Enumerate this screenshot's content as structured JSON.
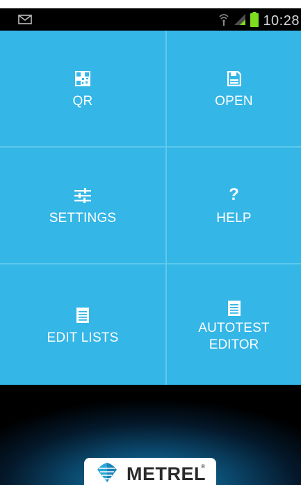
{
  "status_bar": {
    "time": "10:28",
    "icons": [
      "mail-icon",
      "wifi-icon",
      "signal-icon",
      "battery-icon"
    ],
    "battery_color": "#7ddc1f"
  },
  "menu": {
    "tiles": [
      {
        "label": "QR",
        "icon": "qr-code-icon"
      },
      {
        "label": "OPEN",
        "icon": "save-disk-icon"
      },
      {
        "label": "SETTINGS",
        "icon": "sliders-icon"
      },
      {
        "label": "HELP",
        "icon": "question-mark-icon"
      },
      {
        "label": "EDIT LISTS",
        "icon": "list-document-icon"
      },
      {
        "label": "AUTOTEST",
        "label2": "EDITOR",
        "icon": "list-document-icon"
      }
    ],
    "tile_color": "#34b6e6",
    "divider_color": "#5ec9ee"
  },
  "branding": {
    "logo_text": "METREL",
    "registered_mark": "®"
  }
}
